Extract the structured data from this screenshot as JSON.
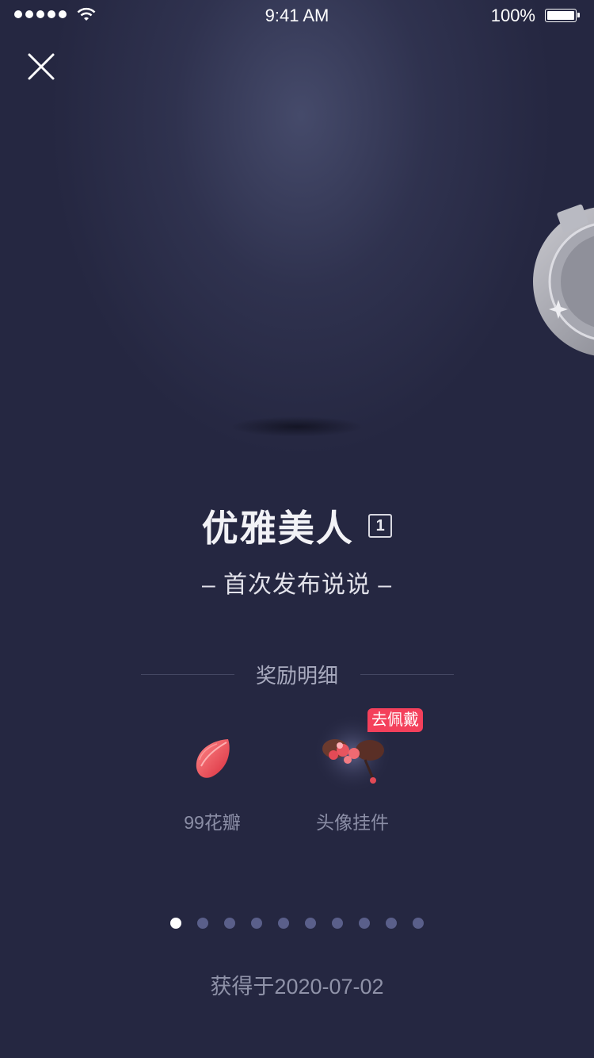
{
  "status_bar": {
    "time": "9:41 AM",
    "battery": "100%",
    "signal_dots": 5
  },
  "achievement": {
    "title": "优雅美人",
    "level": "1",
    "subtitle": "– 首次发布说说 –"
  },
  "rewards_section": {
    "title": "奖励明细",
    "items": [
      {
        "label": "99花瓣",
        "icon": "petal-icon"
      },
      {
        "label": "头像挂件",
        "icon": "avatar-pendant-icon",
        "tag": "去佩戴"
      }
    ]
  },
  "pagination": {
    "total": 10,
    "current": 1
  },
  "obtained_date": "获得于2020-07-02",
  "colors": {
    "background": "#252741",
    "accent": "#f4405b",
    "dot_inactive": "#5a5f8a",
    "dot_active": "#ffffff"
  }
}
